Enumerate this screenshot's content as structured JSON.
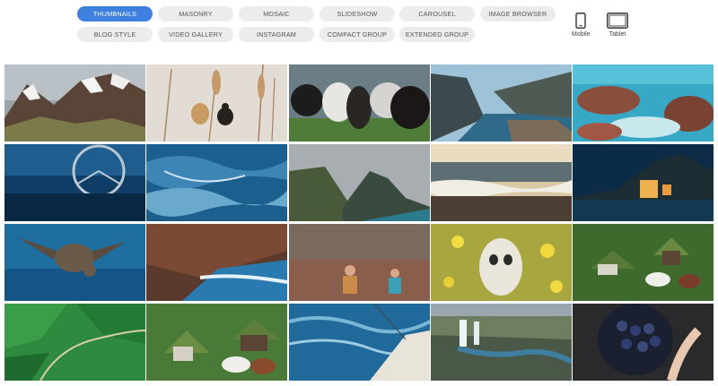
{
  "tabs": [
    {
      "label": "THUMBNAILS",
      "active": true
    },
    {
      "label": "MASONRY"
    },
    {
      "label": "MOSAIC"
    },
    {
      "label": "SLIDESHOW"
    },
    {
      "label": "CAROUSEL"
    },
    {
      "label": "IMAGE BROWSER"
    },
    {
      "label": "BLOG STYLE"
    },
    {
      "label": "VIDEO GALLERY"
    },
    {
      "label": "INSTAGRAM"
    },
    {
      "label": "COMPACT GROUP"
    },
    {
      "label": "EXTENDED GROUP"
    }
  ],
  "devices": {
    "mobile": {
      "label": "Mobile",
      "icon": "mobile-phone-icon"
    },
    "tablet": {
      "label": "Tablet",
      "icon": "tablet-icon"
    }
  },
  "colors": {
    "accent": "#3f7fe0",
    "pill_bg": "#ececec",
    "pill_text": "#555555"
  },
  "gallery": [
    {
      "name": "snowy-mountains"
    },
    {
      "name": "bird-on-reeds"
    },
    {
      "name": "horses"
    },
    {
      "name": "fjord-viewpoint"
    },
    {
      "name": "rocky-coast-turquoise"
    },
    {
      "name": "underwater-car"
    },
    {
      "name": "blue-waves"
    },
    {
      "name": "sea-cliffs"
    },
    {
      "name": "beach-waves-sunset"
    },
    {
      "name": "night-harbor-town"
    },
    {
      "name": "sea-turtle"
    },
    {
      "name": "coastal-cliffs-waves"
    },
    {
      "name": "children-in-field"
    },
    {
      "name": "owl-in-flowers"
    },
    {
      "name": "turf-houses-horse"
    },
    {
      "name": "green-fields-aerial"
    },
    {
      "name": "turf-houses-horses"
    },
    {
      "name": "sailboat-bow-waves"
    },
    {
      "name": "waterfalls-river"
    },
    {
      "name": "blueberries-bowl"
    }
  ]
}
